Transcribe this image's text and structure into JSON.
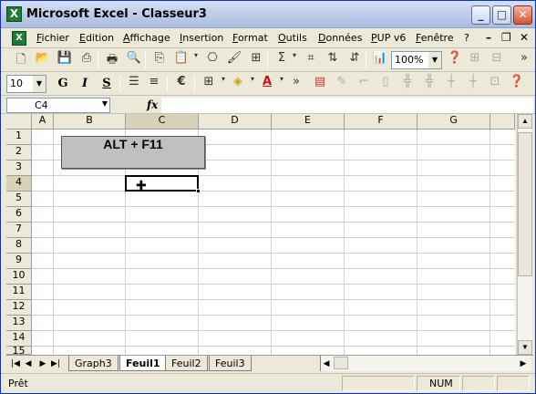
{
  "window": {
    "title": "Microsoft Excel - Classeur3",
    "app_icon": "excel-icon"
  },
  "title_buttons": {
    "minimize": "_",
    "maximize": "□",
    "close": "✕"
  },
  "menu": {
    "items": [
      "Fichier",
      "Edition",
      "Affichage",
      "Insertion",
      "Format",
      "Outils",
      "Données",
      "PUP v6",
      "Fenêtre",
      "?"
    ],
    "ctrl_min": "–",
    "ctrl_restore": "❐",
    "ctrl_close": "✕"
  },
  "toolbar_standard": {
    "zoom": "100%",
    "more": "»"
  },
  "toolbar_format": {
    "font_size": "10",
    "bold": "G",
    "italic": "I",
    "underline": "S",
    "more": "»"
  },
  "formula_bar": {
    "name_box": "C4",
    "fx_label": "fx",
    "formula": ""
  },
  "grid": {
    "columns": [
      "A",
      "B",
      "C",
      "D",
      "E",
      "F",
      "G"
    ],
    "rows": [
      "1",
      "2",
      "3",
      "4",
      "5",
      "6",
      "7",
      "8",
      "9",
      "10",
      "11",
      "12",
      "13",
      "14",
      "15"
    ],
    "selected_column": "C",
    "selected_row": "4",
    "shape_text": "ALT + F11"
  },
  "sheets": {
    "tabs": [
      "Graph3",
      "Feuil1",
      "Feuil2",
      "Feuil3"
    ],
    "active": "Feuil1",
    "nav": [
      "|◀",
      "◀",
      "▶",
      "▶|"
    ]
  },
  "status": {
    "left": "Prêt",
    "num": "NUM"
  }
}
